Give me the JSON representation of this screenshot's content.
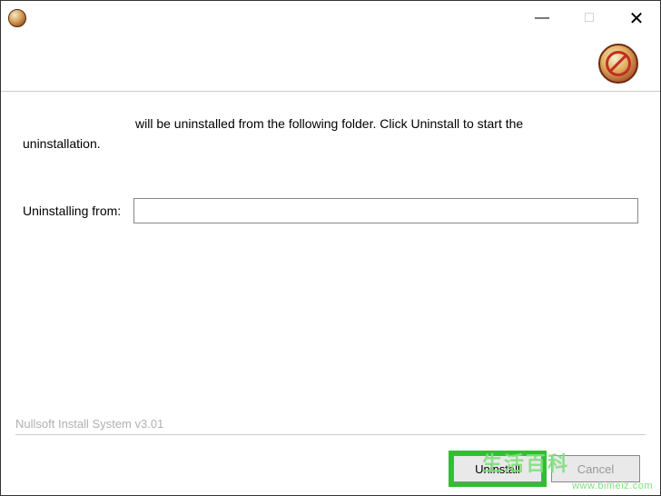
{
  "titlebar": {
    "minimize_glyph": "—",
    "maximize_glyph": "□",
    "close_glyph": "✕"
  },
  "instruction": {
    "line1": "will be uninstalled from the following folder. Click Uninstall to start the",
    "line2": "uninstallation."
  },
  "path": {
    "label": "Uninstalling from:",
    "value": ""
  },
  "footer": {
    "branding": "Nullsoft Install System v3.01"
  },
  "buttons": {
    "uninstall": "Uninstall",
    "cancel": "Cancel"
  },
  "watermark": {
    "cn": "生活百科",
    "url": "www.bimeiz.com"
  }
}
